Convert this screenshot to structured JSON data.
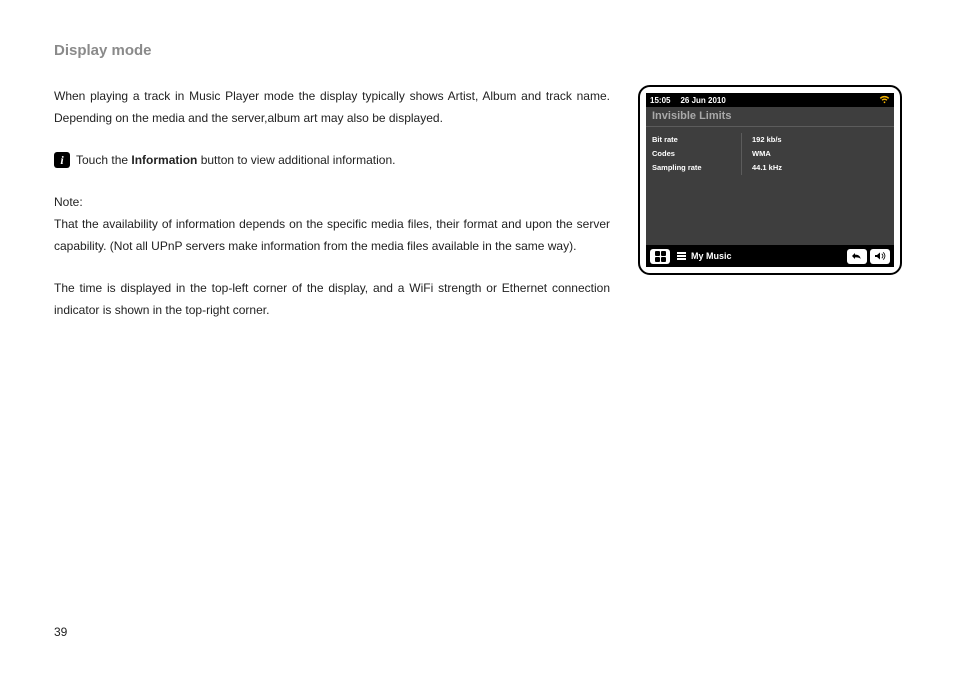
{
  "title": "Display mode",
  "para1": "When playing a track in Music Player mode the display typically shows Artist, Album and track name. Depending on the media and the server,album art may also be displayed.",
  "info_prefix": "Touch the ",
  "info_bold": "Information",
  "info_suffix": " button to view additional information.",
  "note_label": "Note:",
  "para3": "That the availability of information depends on the specific media files, their format and upon the server capability. (Not all UPnP servers make information from the media files available in the same way).",
  "para4": "The time is displayed in the top-left corner of the display, and a WiFi strength or Ethernet connection indicator is shown in the top-right corner.",
  "device": {
    "time": "15:05",
    "date": "26 Jun 2010",
    "track": "Invisible Limits",
    "rows": [
      {
        "label": "Bit rate",
        "value": "192 kb/s"
      },
      {
        "label": "Codes",
        "value": "WMA"
      },
      {
        "label": "Sampling rate",
        "value": "44.1  kHz"
      }
    ],
    "mode": "My Music"
  },
  "page_num": "39"
}
